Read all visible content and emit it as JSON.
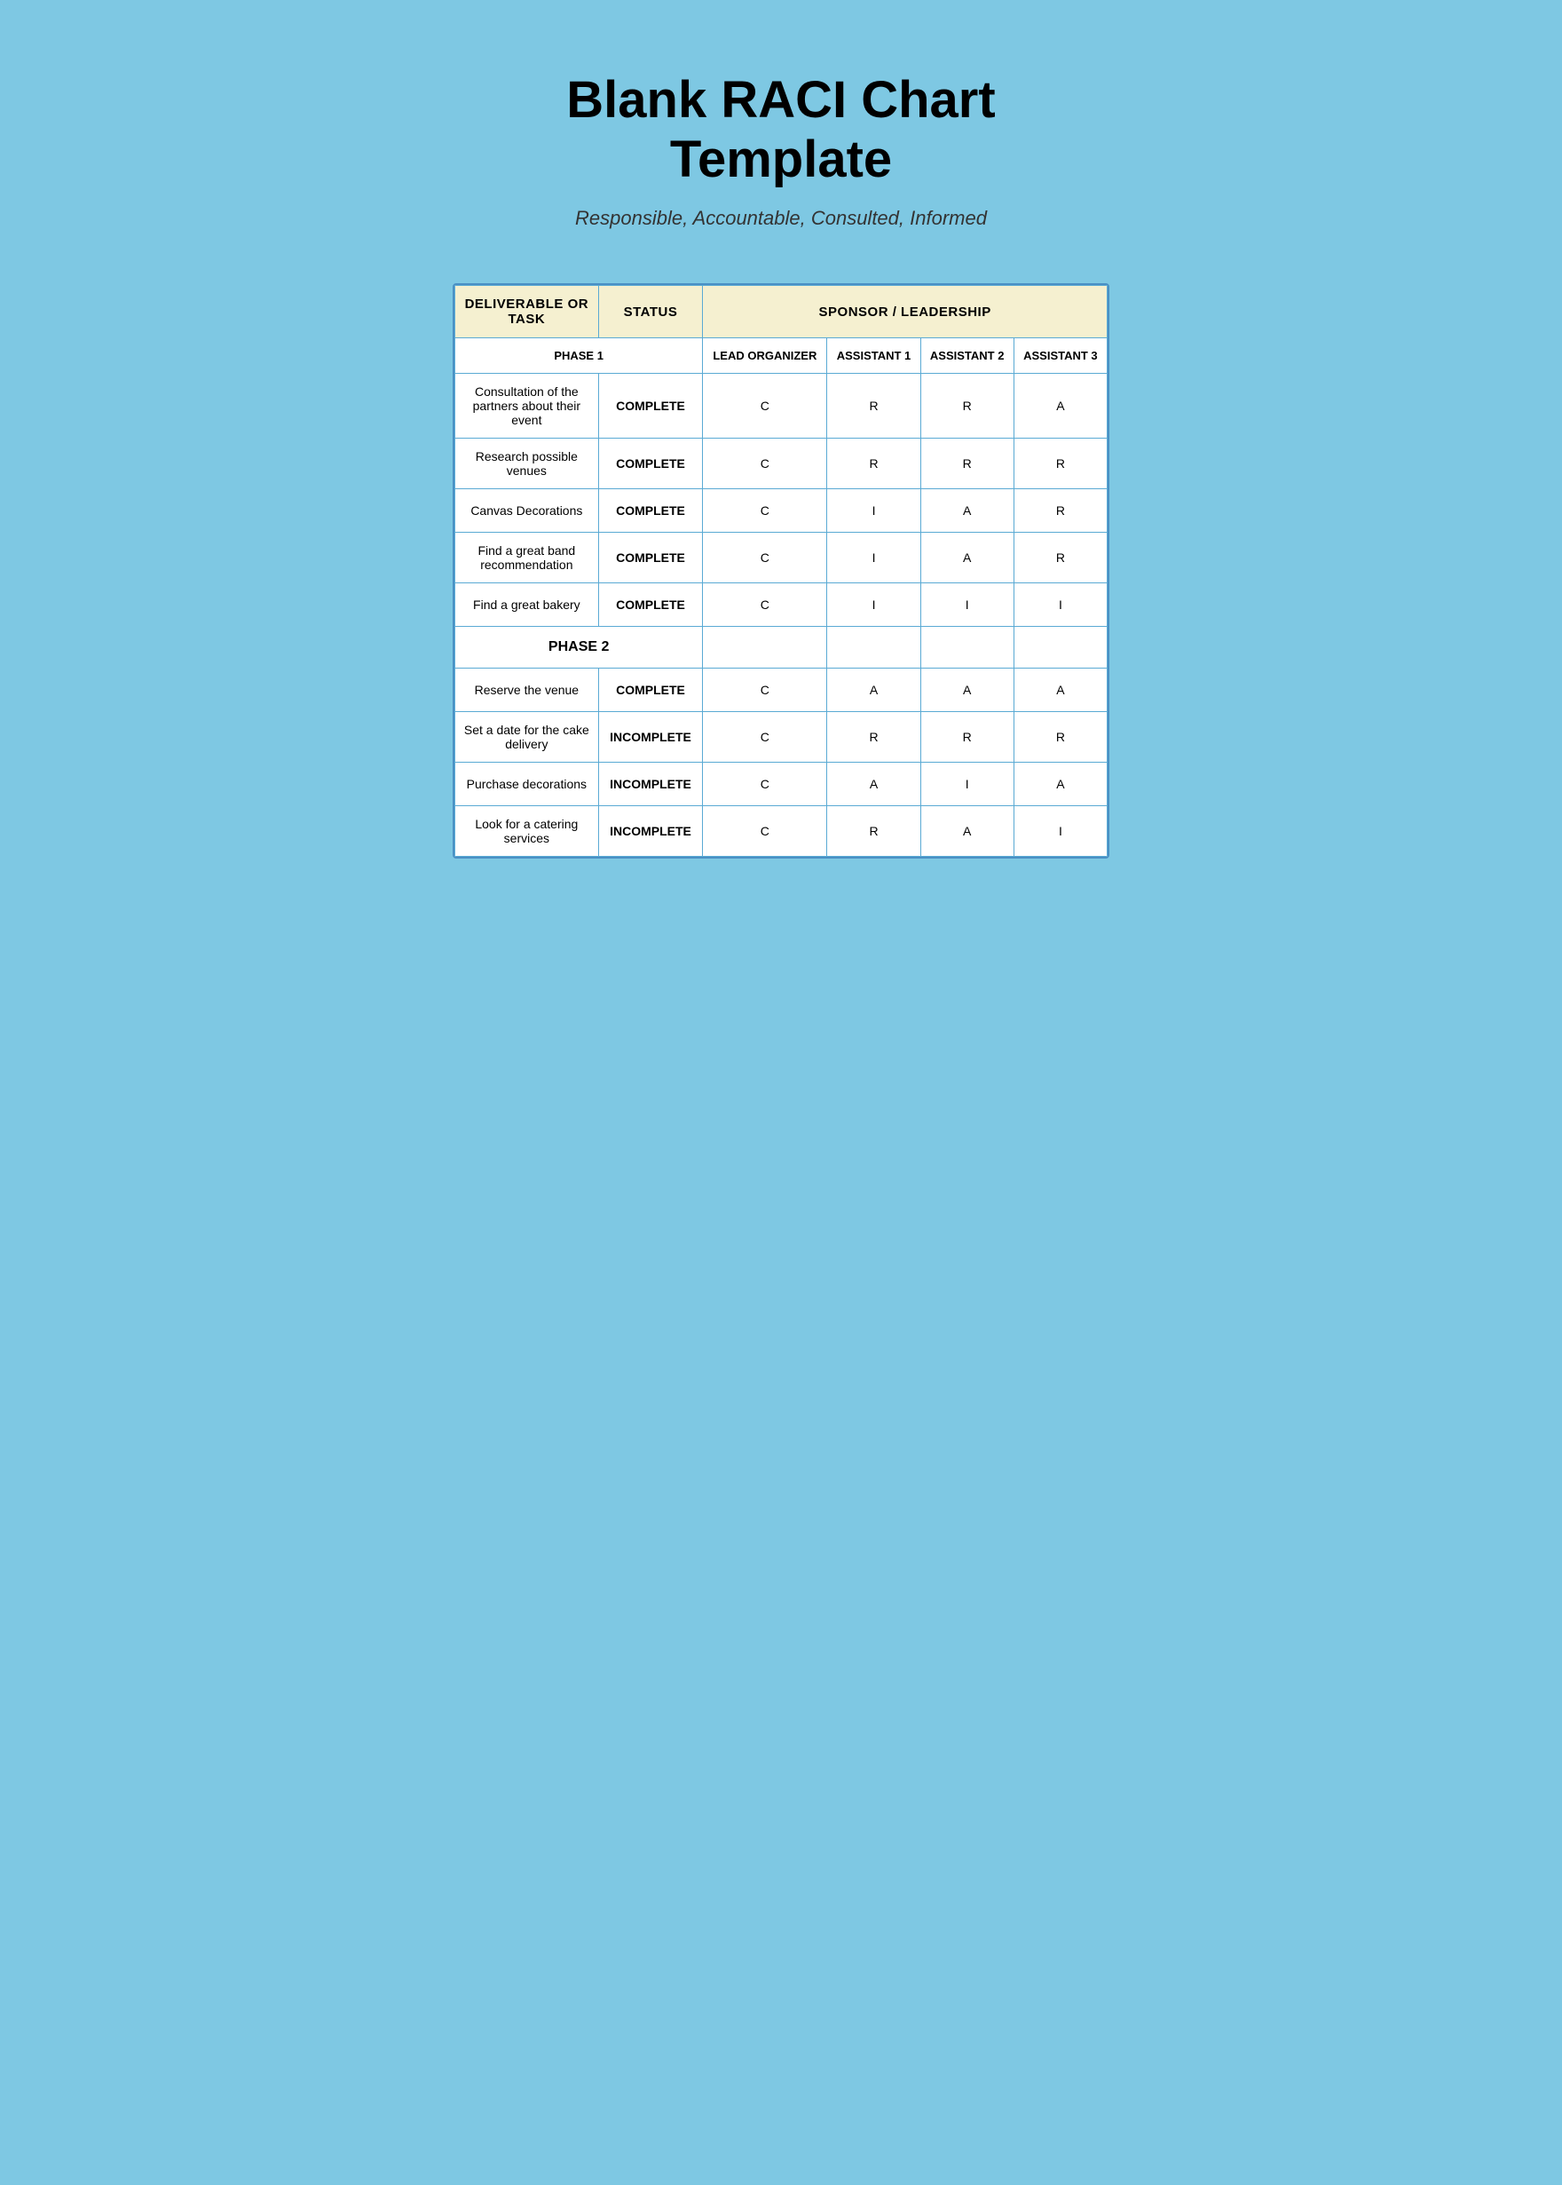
{
  "title": {
    "main": "Blank RACI Chart Template",
    "subtitle": "Responsible, Accountable, Consulted, Informed"
  },
  "table": {
    "headers": {
      "deliverable": "DELIVERABLE OR TASK",
      "status": "STATUS",
      "sponsor": "SPONSOR / LEADERSHIP"
    },
    "subHeaders": {
      "phase": "PHASE 1",
      "leadOrganizer": "LEAD ORGANIZER",
      "assistant1": "ASSISTANT 1",
      "assistant2": "ASSISTANT 2",
      "assistant3": "ASSISTANT 3"
    },
    "phase1": {
      "label": "PHASE 1",
      "rows": [
        {
          "task": "Consultation of the partners about their event",
          "status": "COMPLETE",
          "lead": "C",
          "a1": "R",
          "a2": "R",
          "a3": "A"
        },
        {
          "task": "Research possible venues",
          "status": "COMPLETE",
          "lead": "C",
          "a1": "R",
          "a2": "R",
          "a3": "R"
        },
        {
          "task": "Canvas Decorations",
          "status": "COMPLETE",
          "lead": "C",
          "a1": "I",
          "a2": "A",
          "a3": "R"
        },
        {
          "task": "Find a great band recommendation",
          "status": "COMPLETE",
          "lead": "C",
          "a1": "I",
          "a2": "A",
          "a3": "R"
        },
        {
          "task": "Find a great bakery",
          "status": "COMPLETE",
          "lead": "C",
          "a1": "I",
          "a2": "I",
          "a3": "I"
        }
      ]
    },
    "phase2": {
      "label": "PHASE 2",
      "rows": [
        {
          "task": "Reserve the venue",
          "status": "COMPLETE",
          "lead": "C",
          "a1": "A",
          "a2": "A",
          "a3": "A"
        },
        {
          "task": "Set a date for the cake delivery",
          "status": "INCOMPLETE",
          "lead": "C",
          "a1": "R",
          "a2": "R",
          "a3": "R"
        },
        {
          "task": "Purchase decorations",
          "status": "INCOMPLETE",
          "lead": "C",
          "a1": "A",
          "a2": "I",
          "a3": "A"
        },
        {
          "task": "Look for a catering services",
          "status": "INCOMPLETE",
          "lead": "C",
          "a1": "R",
          "a2": "A",
          "a3": "I"
        }
      ]
    }
  }
}
